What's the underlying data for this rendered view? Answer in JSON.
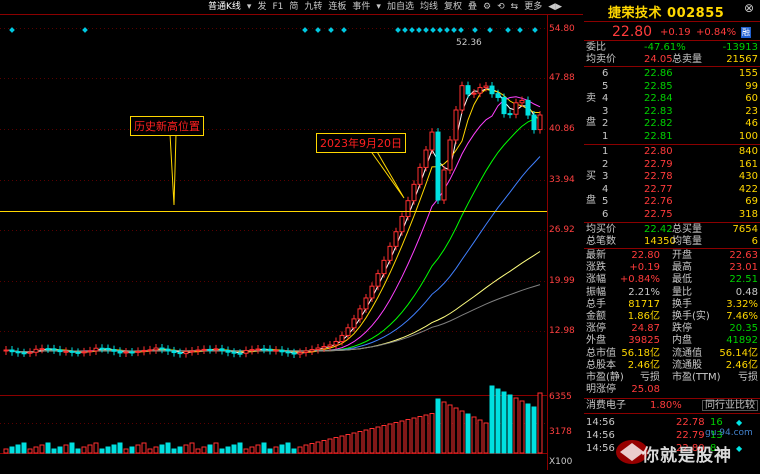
{
  "toolbar": {
    "items": [
      "普通K线",
      "▾",
      "发",
      "F1",
      "简",
      "九转",
      "连板",
      "事件",
      "▾",
      "加自选",
      "均线",
      "复权",
      "叠",
      "⚙",
      "⟲",
      "⇆",
      "更多",
      "◀▶"
    ]
  },
  "price_axis": [
    "54.80",
    "47.88",
    "40.86",
    "33.94",
    "26.92",
    "19.99",
    "12.98"
  ],
  "volume_axis": [
    "6355",
    "3178",
    "X100"
  ],
  "annotations": {
    "high_label": "历史新高位置",
    "date_label": "2023年9月20日",
    "peak_price": "52.36"
  },
  "stock": {
    "name": "捷荣技术 002855",
    "price": "22.80",
    "change": "+0.19",
    "change_pct": "+0.84%",
    "flag": "融"
  },
  "order_book": {
    "weibi_label": "委比",
    "weibi_val": "-47.61%",
    "weibi_diff": "-13913",
    "avg_sell_label": "均卖价",
    "avg_sell": "24.05",
    "total_sell_label": "总卖量",
    "total_sell": "21567",
    "sell_label_1": "卖",
    "sell_label_2": "盘",
    "asks": [
      {
        "lvl": "6",
        "price": "22.86",
        "vol": "155"
      },
      {
        "lvl": "5",
        "price": "22.85",
        "vol": "99"
      },
      {
        "lvl": "4",
        "price": "22.84",
        "vol": "60"
      },
      {
        "lvl": "3",
        "price": "22.83",
        "vol": "23"
      },
      {
        "lvl": "2",
        "price": "22.82",
        "vol": "46"
      },
      {
        "lvl": "1",
        "price": "22.81",
        "vol": "100"
      }
    ],
    "buy_label_1": "买",
    "buy_label_2": "盘",
    "bids": [
      {
        "lvl": "1",
        "price": "22.80",
        "vol": "840"
      },
      {
        "lvl": "2",
        "price": "22.79",
        "vol": "161"
      },
      {
        "lvl": "3",
        "price": "22.78",
        "vol": "430"
      },
      {
        "lvl": "4",
        "price": "22.77",
        "vol": "422"
      },
      {
        "lvl": "5",
        "price": "22.76",
        "vol": "69"
      },
      {
        "lvl": "6",
        "price": "22.75",
        "vol": "318"
      }
    ],
    "avg_buy_label": "均买价",
    "avg_buy": "22.42",
    "total_buy_label": "总买量",
    "total_buy": "7654",
    "trades_label": "总笔数",
    "trades": "14350",
    "avg_amt_label": "均笔量",
    "avg_amt": "6"
  },
  "stats": [
    {
      "l1": "最新",
      "v1": "22.80",
      "c1": "r",
      "l2": "开盘",
      "v2": "22.63",
      "c2": "r"
    },
    {
      "l1": "涨跌",
      "v1": "+0.19",
      "c1": "r",
      "l2": "最高",
      "v2": "23.01",
      "c2": "r"
    },
    {
      "l1": "涨幅",
      "v1": "+0.84%",
      "c1": "r",
      "l2": "最低",
      "v2": "22.51",
      "c2": "g"
    },
    {
      "l1": "振幅",
      "v1": "2.21%",
      "c1": "w",
      "l2": "量比",
      "v2": "0.48",
      "c2": "w"
    },
    {
      "l1": "总手",
      "v1": "81717",
      "c1": "y",
      "l2": "换手",
      "v2": "3.32%",
      "c2": "y"
    },
    {
      "l1": "金额",
      "v1": "1.86亿",
      "c1": "y",
      "l2": "换手(实)",
      "v2": "7.46%",
      "c2": "y"
    },
    {
      "l1": "涨停",
      "v1": "24.87",
      "c1": "r",
      "l2": "跌停",
      "v2": "20.35",
      "c2": "g"
    },
    {
      "l1": "外盘",
      "v1": "39825",
      "c1": "r",
      "l2": "内盘",
      "v2": "41892",
      "c2": "g"
    },
    {
      "l1": "总市值",
      "v1": "56.18亿",
      "c1": "y",
      "l2": "流通值",
      "v2": "56.14亿",
      "c2": "y"
    },
    {
      "l1": "总股本",
      "v1": "2.46亿",
      "c1": "y",
      "l2": "流通股",
      "v2": "2.46亿",
      "c2": "y"
    },
    {
      "l1": "市盈(静)",
      "v1": "亏损",
      "c1": "w",
      "l2": "市盈(TTM)",
      "v2": "亏损",
      "c2": "w"
    },
    {
      "l1": "明涨停",
      "v1": "25.08",
      "c1": "r",
      "l2": "",
      "v2": "",
      "c2": "w"
    }
  ],
  "sector": {
    "name": "消费电子",
    "pct": "1.80%",
    "compare": "同行业比较"
  },
  "ticks": [
    {
      "time": "14:56",
      "price": "22.78",
      "vol": "16",
      "flag": "◆"
    },
    {
      "time": "14:56",
      "price": "22.79",
      "vol": "13",
      "flag": ""
    },
    {
      "time": "14:56",
      "price": "22.80",
      "vol": "8",
      "flag": "◆"
    }
  ],
  "watermark": {
    "text": "你就是股神",
    "url": "gu.94.com"
  }
}
